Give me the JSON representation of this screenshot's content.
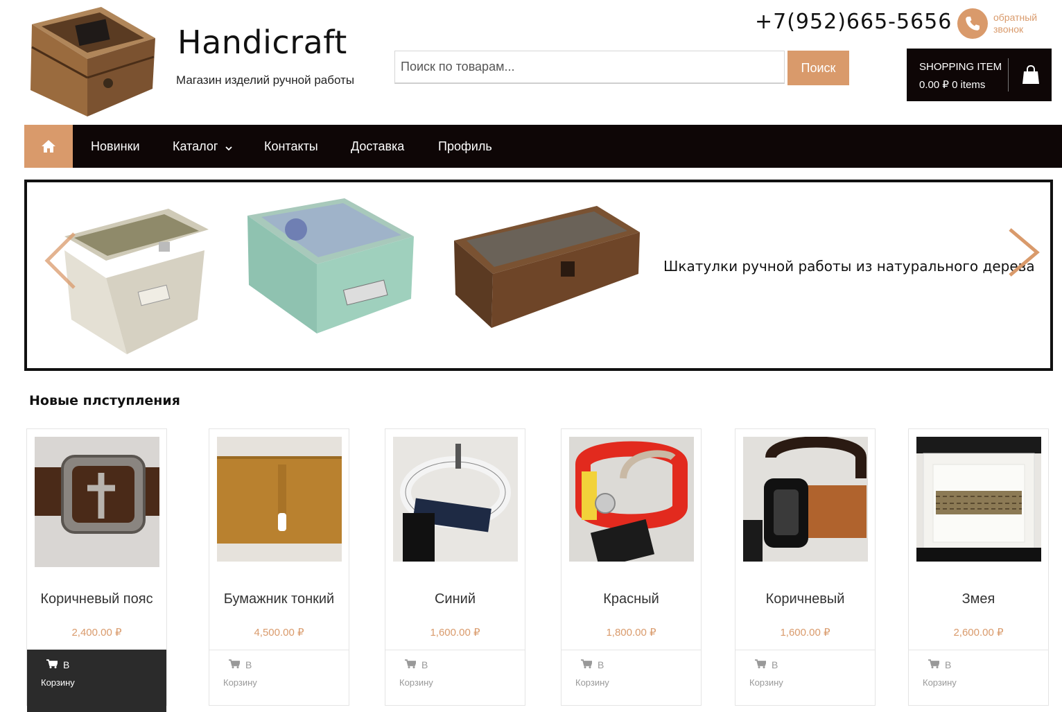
{
  "header": {
    "site_title": "Handicraft",
    "tagline": "Магазин изделий ручной работы",
    "search_placeholder": "Поиск по товарам...",
    "search_button": "Поиск",
    "phone": "+7(952)665-5656",
    "callback_line1": "обратный",
    "callback_line2": "звонок",
    "cart_title": "SHOPPING ITEM",
    "cart_summary": "0.00 ₽ 0 items"
  },
  "nav": {
    "items": [
      {
        "label": "Новинки"
      },
      {
        "label": "Каталог"
      },
      {
        "label": "Контакты"
      },
      {
        "label": "Доставка"
      },
      {
        "label": "Профиль"
      }
    ]
  },
  "slider": {
    "caption": "Шкатулки ручной работы из натурального дерева"
  },
  "new_arrivals": {
    "title": "Новые плступления",
    "add_to_cart_line1": "В",
    "add_to_cart_line2": "Корзину",
    "products": [
      {
        "name": "Коричневый пояс",
        "price": "2,400.00 ₽"
      },
      {
        "name": "Бумажник тонкий",
        "price": "4,500.00 ₽"
      },
      {
        "name": "Синий",
        "price": "1,600.00 ₽"
      },
      {
        "name": "Красный",
        "price": "1,800.00 ₽"
      },
      {
        "name": "Коричневый",
        "price": "1,600.00 ₽"
      },
      {
        "name": "Змея",
        "price": "2,600.00 ₽"
      }
    ]
  },
  "colors": {
    "accent": "#d99a6b",
    "dark": "#0e0606"
  }
}
